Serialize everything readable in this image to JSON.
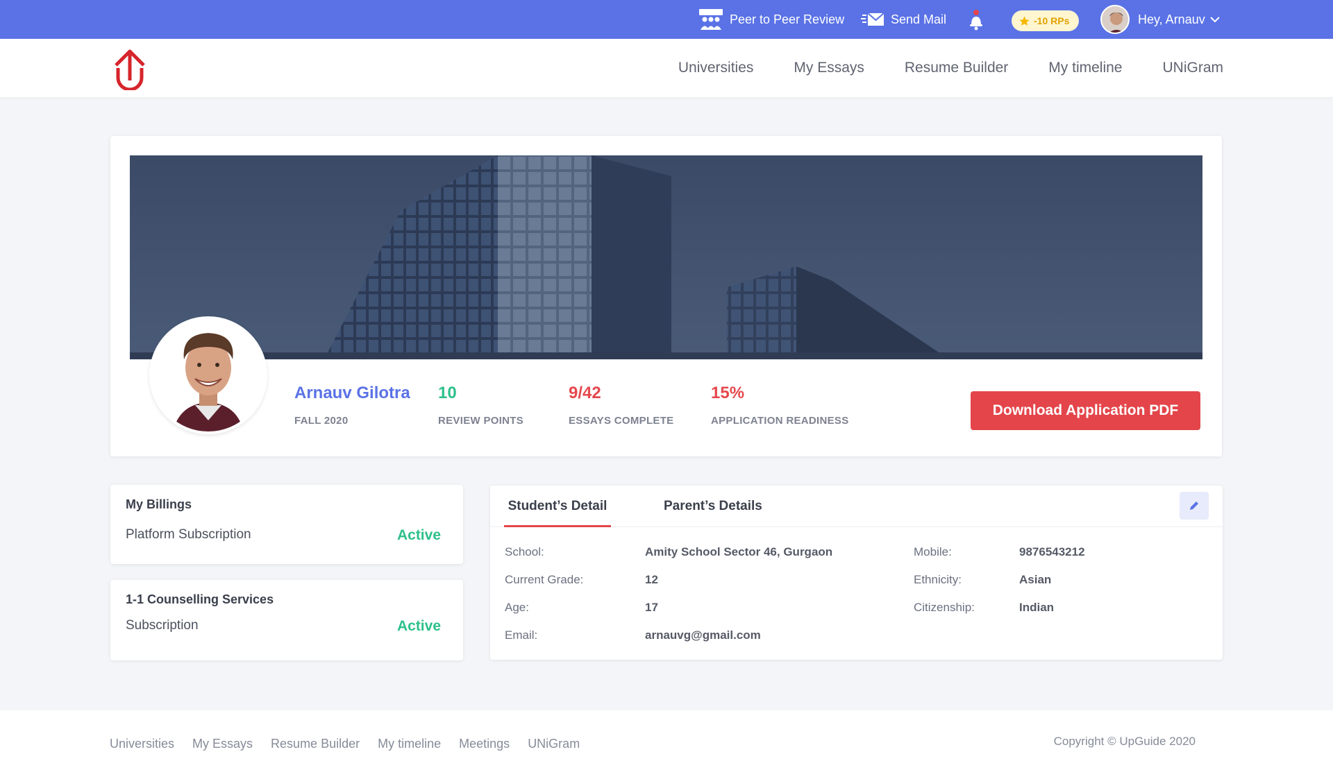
{
  "topbar": {
    "peer_review": "Peer to Peer Review",
    "send_mail": "Send Mail",
    "rps": "-10 RPs",
    "greeting": "Hey, Arnauv"
  },
  "nav": {
    "items": [
      "Universities",
      "My Essays",
      "Resume Builder",
      "My timeline",
      "UNiGram"
    ]
  },
  "profile": {
    "name": "Arnauv Gilotra",
    "term": "FALL 2020",
    "stats": [
      {
        "value": "10",
        "label": "REVIEW POINTS"
      },
      {
        "value": "9/42",
        "label": "ESSAYS COMPLETE"
      },
      {
        "value": "15%",
        "label": "APPLICATION READINESS"
      }
    ],
    "download_label": "Download Application PDF"
  },
  "billing": {
    "title": "My Billings",
    "item": "Platform Subscription",
    "status": "Active"
  },
  "counselling": {
    "title": "1-1 Counselling Services",
    "item": "Subscription",
    "status": "Active"
  },
  "details": {
    "tabs": [
      "Student’s Detail",
      "Parent’s Details"
    ],
    "left": [
      {
        "label": "School:",
        "value": "Amity School Sector 46, Gurgaon"
      },
      {
        "label": "Current Grade:",
        "value": "12"
      },
      {
        "label": "Age:",
        "value": "17"
      },
      {
        "label": "Email:",
        "value": "arnauvg@gmail.com"
      }
    ],
    "right": [
      {
        "label": "Mobile:",
        "value": "9876543212"
      },
      {
        "label": "Ethnicity:",
        "value": "Asian"
      },
      {
        "label": "Citizenship:",
        "value": "Indian"
      }
    ]
  },
  "footer": {
    "links": [
      "Universities",
      "My Essays",
      "Resume Builder",
      "My timeline",
      "Meetings",
      "UNiGram"
    ],
    "copyright": "Copyright © UpGuide 2020"
  },
  "colors": {
    "topbar": "#5a72e6",
    "accent_red": "#e3454a",
    "active_green": "#2ec08b"
  }
}
